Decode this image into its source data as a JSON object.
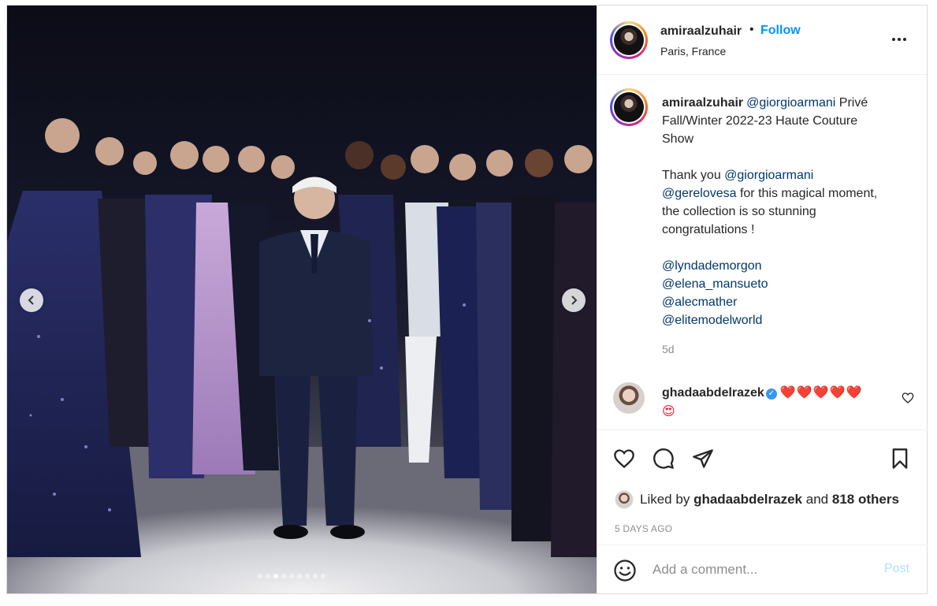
{
  "post": {
    "username": "amiraalzuhair",
    "separator": "•",
    "follow_label": "Follow",
    "location": "Paris, France",
    "more_icon": "more-horizontal-icon"
  },
  "caption": {
    "username": "amiraalzuhair",
    "mention_1": "@giorgioarmani",
    "text_1a": " Privé",
    "text_1b": "Fall/Winter 2022-23 Haute Couture",
    "text_1c": "Show",
    "text_2a": "Thank you ",
    "mention_2": "@giorgioarmani",
    "mention_3": "@gerelovesa",
    "text_2b": " for this magical moment,",
    "text_2c": "the collection is so stunning",
    "text_2d": "congratulations !",
    "tags": [
      "@lyndademorgon",
      "@elena_mansueto",
      "@alecmather",
      "@elitemodelworld"
    ],
    "age": "5d"
  },
  "comment": {
    "username": "ghadaabdelrazek",
    "verified_icon": "verified-badge-icon",
    "text_line1": "❤️❤️❤️❤️❤️",
    "text_line2": "😍"
  },
  "actions": {
    "liked_prefix": "Liked by ",
    "liked_user": "ghadaabdelrazek",
    "liked_middle": " and ",
    "liked_others": "818 others",
    "posted_ago": "5 DAYS AGO"
  },
  "add_comment": {
    "placeholder": "Add a comment...",
    "post_label": "Post"
  },
  "carousel": {
    "slide_count": 9,
    "active_index": 2
  },
  "colors": {
    "follow": "#0095f6",
    "mention": "#00376b",
    "post_disabled": "#b2dffc",
    "verified": "#3897f0"
  }
}
